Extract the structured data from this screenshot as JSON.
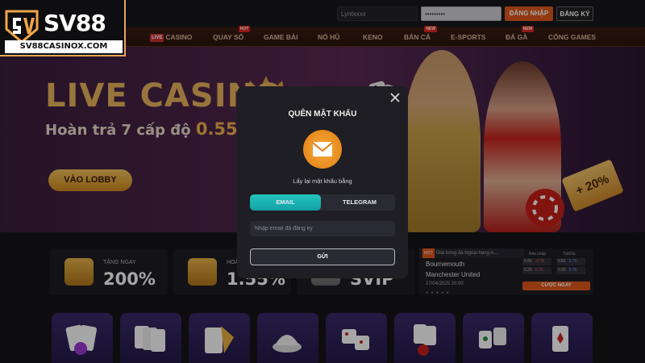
{
  "header": {
    "logo_text": "SV88",
    "logo_domain": "SV88CASINOX.COM",
    "username_value": "Lyntxxxx",
    "password_value": "•••••••••",
    "login_label": "ĐĂNG NHẬP",
    "register_label": "ĐĂNG KÝ"
  },
  "nav": {
    "live_tag": "LIVE",
    "items": [
      "CASINO",
      "QUAY SỐ",
      "GAME BÀI",
      "NỔ HŨ",
      "KENO",
      "BẮN CÁ",
      "E-SPORTS",
      "ĐÁ GÀ",
      "CỔNG GAMES"
    ],
    "badges": {
      "hot": "HOT",
      "new": "NEW"
    }
  },
  "banner": {
    "title": "LIVE CASINO",
    "subtitle_prefix": "Hoàn trả 7 cấp độ ",
    "subtitle_value": "0.55%",
    "subtitle_suffix": " -",
    "button": "VÀO LOBBY",
    "promo": "+ 20%"
  },
  "stats": [
    {
      "label": "TẶNG NGAY",
      "value": "200%"
    },
    {
      "label": "HOÀN TRẢ",
      "value": "1.55%"
    },
    {
      "label": "",
      "value": "SVIP"
    }
  ],
  "match": {
    "tag": "HOT",
    "header": "Giải bóng đá Ngoại hạng A...",
    "team1": "Bournemouth",
    "team2": "Manchester United",
    "date": "27/04/2025 20:00",
    "odds_headers": [
      "Kèo chấp",
      "Tài/Xỉu"
    ],
    "odds": [
      {
        "h": "0.81",
        "a": "-0.75",
        "o": "0.81",
        "u": "0.75"
      },
      {
        "h": "0.25",
        "a": "0.75",
        "o": "0.25",
        "u": "0.75"
      },
      {
        "h": "0.81",
        "a": "0.80",
        "o": "0.81",
        "u": "0.75"
      }
    ],
    "bet_button": "CƯỢC NGAY"
  },
  "modal": {
    "title": "QUÊN MẬT KHẨU",
    "hint": "Lấy lại mật khẩu bằng",
    "tab_email": "EMAIL",
    "tab_telegram": "TELEGRAM",
    "email_placeholder": "Nhập email đã đăng ký",
    "submit": "GỬI",
    "accent": "#1cb4b4"
  }
}
